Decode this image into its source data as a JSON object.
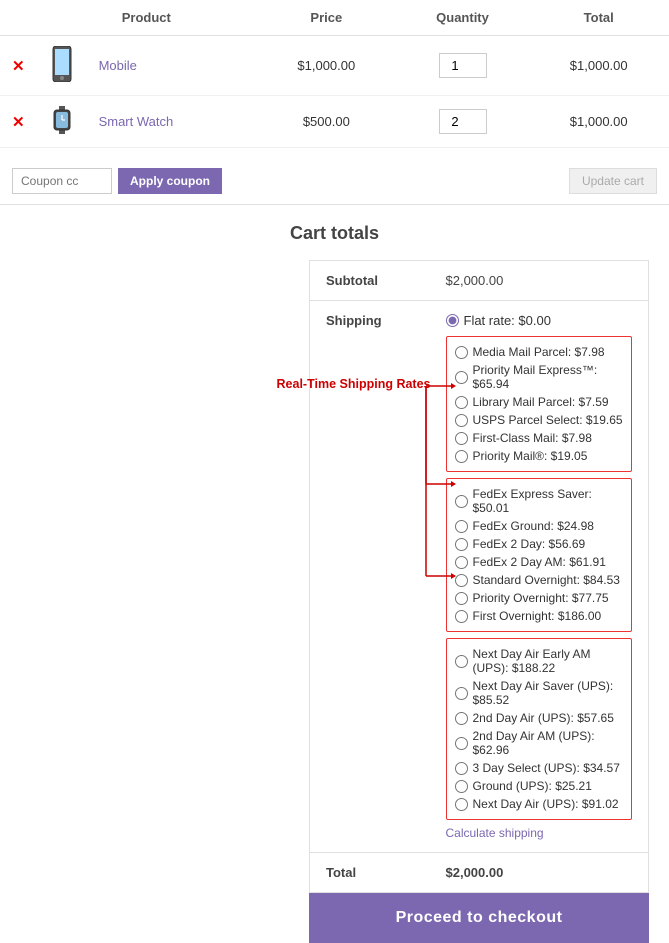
{
  "header": {
    "col_product": "Product",
    "col_price": "Price",
    "col_quantity": "Quantity",
    "col_total": "Total"
  },
  "cart_items": [
    {
      "id": "item-mobile",
      "name": "Mobile",
      "price": "$1,000.00",
      "quantity": "1",
      "total": "$1,000.00"
    },
    {
      "id": "item-smartwatch",
      "name": "Smart Watch",
      "price": "$500.00",
      "quantity": "2",
      "total": "$1,000.00"
    }
  ],
  "coupon": {
    "input_placeholder": "Coupon cc",
    "apply_label": "Apply coupon",
    "update_label": "Update cart"
  },
  "cart_totals": {
    "title": "Cart totals",
    "subtotal_label": "Subtotal",
    "subtotal_value": "$2,000.00",
    "shipping_label": "Shipping",
    "flat_rate_label": "Flat rate: $0.00",
    "usps_options": [
      {
        "label": "Media Mail Parcel: $7.98"
      },
      {
        "label": "Priority Mail Express™: $65.94"
      },
      {
        "label": "Library Mail Parcel: $7.59"
      },
      {
        "label": "USPS Parcel Select: $19.65"
      },
      {
        "label": "First-Class Mail: $7.98"
      },
      {
        "label": "Priority Mail®: $19.05"
      }
    ],
    "fedex_options": [
      {
        "label": "FedEx Express Saver: $50.01"
      },
      {
        "label": "FedEx Ground: $24.98"
      },
      {
        "label": "FedEx 2 Day: $56.69"
      },
      {
        "label": "FedEx 2 Day AM: $61.91"
      },
      {
        "label": "Standard Overnight: $84.53"
      },
      {
        "label": "Priority Overnight: $77.75"
      },
      {
        "label": "First Overnight: $186.00"
      }
    ],
    "ups_options": [
      {
        "label": "Next Day Air Early AM (UPS): $188.22"
      },
      {
        "label": "Next Day Air Saver (UPS): $85.52"
      },
      {
        "label": "2nd Day Air (UPS): $57.65"
      },
      {
        "label": "2nd Day Air AM (UPS): $62.96"
      },
      {
        "label": "3 Day Select (UPS): $34.57"
      },
      {
        "label": "Ground (UPS): $25.21"
      },
      {
        "label": "Next Day Air (UPS): $91.02"
      }
    ],
    "calculate_shipping": "Calculate shipping",
    "annotation_label": "Real-Time Shipping Rates",
    "total_label": "Total",
    "total_value": "$2,000.00",
    "checkout_label": "Proceed to checkout"
  }
}
